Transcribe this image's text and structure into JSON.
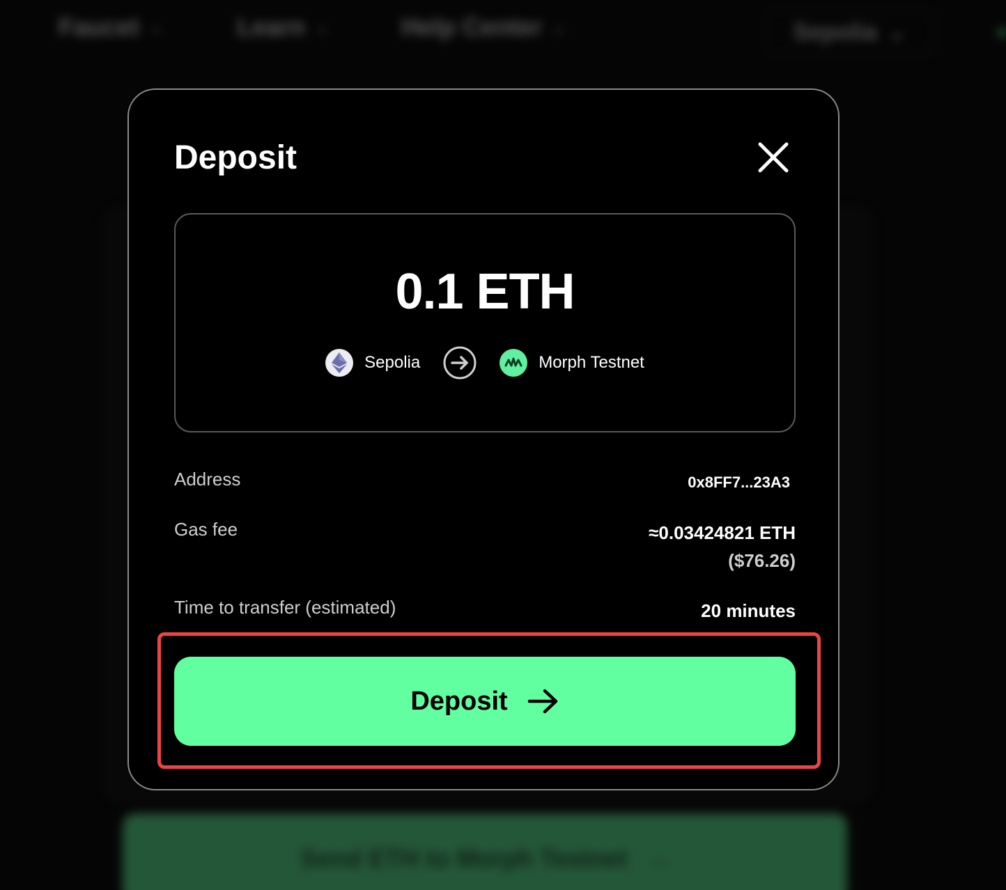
{
  "background": {
    "nav": [
      {
        "label": "Faucet"
      },
      {
        "label": "Learn"
      },
      {
        "label": "Help Center"
      }
    ],
    "network_selector": "Sepolia",
    "send_button_label": "Send ETH to Morph Testnet"
  },
  "modal": {
    "title": "Deposit",
    "amount": "0.1 ETH",
    "from_chain": "Sepolia",
    "to_chain": "Morph Testnet",
    "rows": {
      "address": {
        "label": "Address",
        "value": "0x8FF7...23A3"
      },
      "gas_fee": {
        "label": "Gas fee",
        "value": "≈0.03424821 ETH",
        "sub_value": "($76.26)"
      },
      "time": {
        "label": "Time to transfer (estimated)",
        "value": "20 minutes"
      }
    },
    "deposit_button_label": "Deposit"
  },
  "colors": {
    "accent": "#62ffa0",
    "highlight": "#ef4444",
    "modal_border": "#8a8a8a"
  },
  "icons": [
    "close-icon",
    "ethereum-icon",
    "arrow-right-circle-icon",
    "morph-icon",
    "arrow-right-icon",
    "chevron-down-icon"
  ]
}
